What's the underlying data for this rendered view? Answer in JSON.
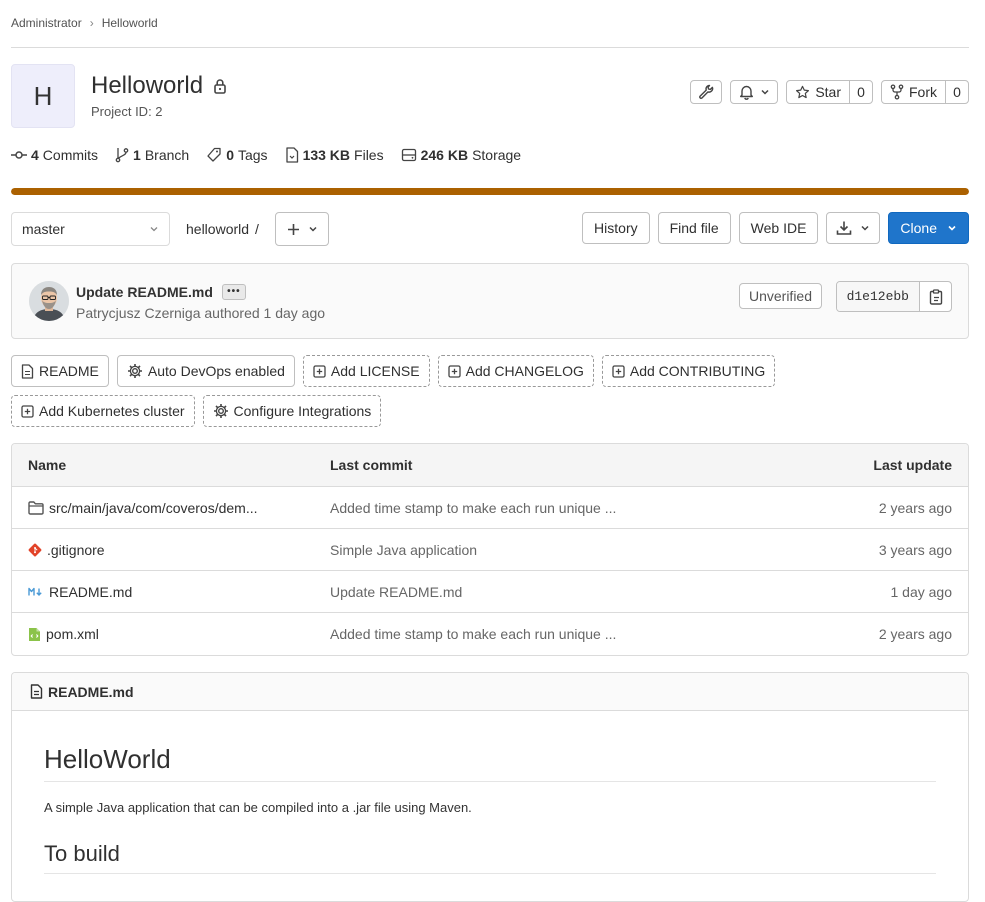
{
  "breadcrumb": {
    "parent": "Administrator",
    "separator": "›",
    "current": "Helloworld"
  },
  "project": {
    "initial": "H",
    "name": "Helloworld",
    "id_text": "Project ID: 2"
  },
  "header_actions": {
    "star_label": "Star",
    "star_count": "0",
    "fork_label": "Fork",
    "fork_count": "0"
  },
  "stats": {
    "commits_count": "4",
    "commits_label": "Commits",
    "branches_count": "1",
    "branches_label": "Branch",
    "tags_count": "0",
    "tags_label": "Tags",
    "files_size": "133 KB",
    "files_label": "Files",
    "storage_size": "246 KB",
    "storage_label": "Storage"
  },
  "storage_bar": {
    "fill_fraction": 1.0,
    "color": "#ab6100"
  },
  "toolbar": {
    "branch": "master",
    "path_root": "helloworld",
    "path_sep": "/",
    "history": "History",
    "find_file": "Find file",
    "web_ide": "Web IDE",
    "clone": "Clone"
  },
  "last_commit": {
    "title": "Update README.md",
    "ellipsis": "•••",
    "author_line": "Patrycjusz Czerniga authored 1 day ago",
    "verification": "Unverified",
    "sha": "d1e12ebb"
  },
  "project_buttons": [
    {
      "name": "readme-button",
      "label": "README",
      "icon": "file-icon",
      "dashed": false
    },
    {
      "name": "auto-devops-button",
      "label": "Auto DevOps enabled",
      "icon": "settings-icon",
      "dashed": false
    },
    {
      "name": "add-license-button",
      "label": "Add LICENSE",
      "icon": "plus-square-icon",
      "dashed": true
    },
    {
      "name": "add-changelog-button",
      "label": "Add CHANGELOG",
      "icon": "plus-square-icon",
      "dashed": true
    },
    {
      "name": "add-contributing-button",
      "label": "Add CONTRIBUTING",
      "icon": "plus-square-icon",
      "dashed": true
    },
    {
      "name": "add-kubernetes-button",
      "label": "Add Kubernetes cluster",
      "icon": "plus-square-icon",
      "dashed": true
    },
    {
      "name": "configure-integrations-button",
      "label": "Configure Integrations",
      "icon": "settings-icon",
      "dashed": true
    }
  ],
  "file_table": {
    "headers": {
      "name": "Name",
      "commit": "Last commit",
      "update": "Last update"
    },
    "rows": [
      {
        "icon": "folder-icon",
        "name": "src/main/java/com/coveros/dem...",
        "commit": "Added time stamp to make each run unique ...",
        "updated": "2 years ago"
      },
      {
        "icon": "git-icon",
        "name": ".gitignore",
        "commit": "Simple Java application",
        "updated": "3 years ago"
      },
      {
        "icon": "markdown-icon",
        "name": "README.md",
        "commit": "Update README.md",
        "updated": "1 day ago"
      },
      {
        "icon": "xml-file-icon",
        "name": "pom.xml",
        "commit": "Added time stamp to make each run unique ...",
        "updated": "2 years ago"
      }
    ]
  },
  "readme": {
    "file_name": "README.md",
    "h1": "HelloWorld",
    "paragraph": "A simple Java application that can be compiled into a .jar file using Maven.",
    "h2": "To build"
  }
}
